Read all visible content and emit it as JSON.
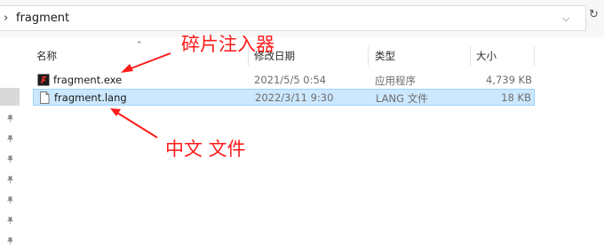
{
  "address_bar": {
    "separator": "›",
    "path": "fragment",
    "dropdown_glyph": "⌵",
    "refresh_glyph": "↻"
  },
  "columns": {
    "name": "名称",
    "date": "修改日期",
    "type": "类型",
    "size": "大小",
    "sort_glyph": "⌃"
  },
  "files": [
    {
      "name": "fragment.exe",
      "date": "2021/5/5 0:54",
      "type": "应用程序",
      "size": "4,739 KB",
      "icon": "app-icon",
      "selected": false
    },
    {
      "name": "fragment.lang",
      "date": "2022/3/11 9:30",
      "type": "LANG 文件",
      "size": "18 KB",
      "icon": "document-icon",
      "selected": true
    }
  ],
  "annotations": {
    "top": "碎片注入器",
    "bottom": "中文 文件"
  },
  "colors": {
    "annotation": "#ff1a1a",
    "selection_bg": "#cce8ff",
    "selection_border": "#99d1ff"
  }
}
